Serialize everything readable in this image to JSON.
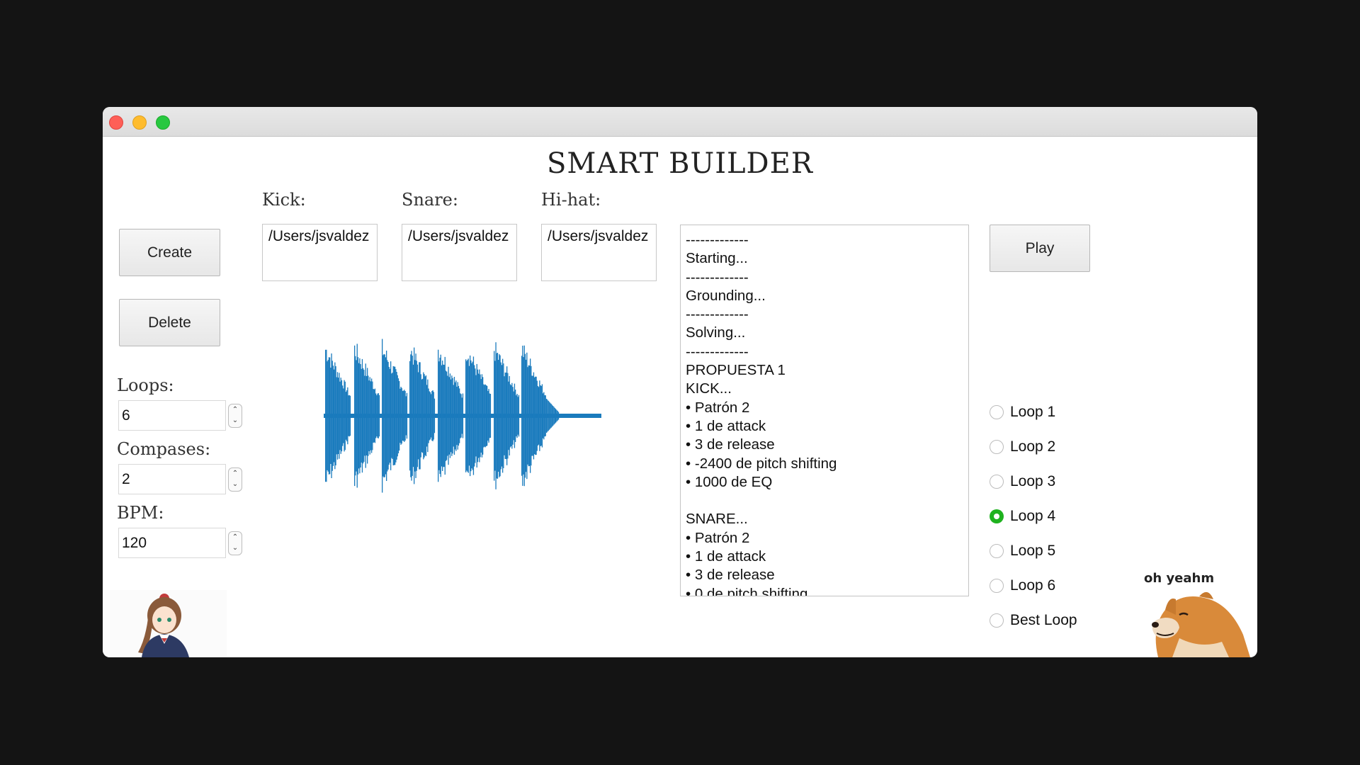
{
  "app": {
    "title": "SMART BUILDER"
  },
  "buttons": {
    "create": "Create",
    "delete": "Delete",
    "play": "Play"
  },
  "params": {
    "loops_label": "Loops:",
    "loops_value": "6",
    "compases_label": "Compases:",
    "compases_value": "2",
    "bpm_label": "BPM:",
    "bpm_value": "120"
  },
  "samples": {
    "kick_label": "Kick:",
    "kick_path": "/Users/jsvaldez",
    "snare_label": "Snare:",
    "snare_path": "/Users/jsvaldez",
    "hihat_label": "Hi-hat:",
    "hihat_path": "/Users/jsvaldez"
  },
  "log": {
    "lines": [
      "-------------",
      "Starting...",
      "-------------",
      "Grounding...",
      "-------------",
      "Solving...",
      "-------------",
      "PROPUESTA 1",
      "KICK...",
      "• Patrón 2",
      "• 1 de attack",
      "• 3 de release",
      "• -2400 de pitch shifting",
      "• 1000 de EQ",
      "",
      "SNARE...",
      "• Patrón 2",
      "• 1 de attack",
      "• 3 de release",
      "• 0 de pitch shifting"
    ]
  },
  "loops": {
    "options": [
      "Loop 1",
      "Loop 2",
      "Loop 3",
      "Loop 4",
      "Loop 5",
      "Loop 6",
      "Best Loop"
    ],
    "selected": "Loop 4"
  },
  "waveform": {
    "color": "#1a7bbd"
  },
  "stickers": {
    "dog_caption": "oh yeahm"
  },
  "colors": {
    "radio_checked": "#1fb21f",
    "waveform": "#1a7bbd"
  }
}
